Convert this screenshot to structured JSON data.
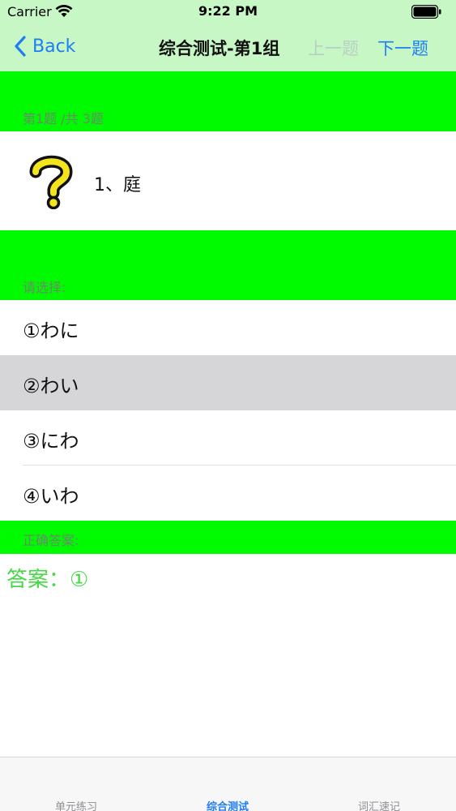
{
  "status_bar": {
    "carrier": "Carrier",
    "time": "9:22 PM"
  },
  "nav": {
    "back_label": "Back",
    "title": "综合测试-第1组",
    "prev_label": "上一题",
    "next_label": "下一题"
  },
  "question": {
    "counter": "第1题 /共 3题",
    "text": "1、庭",
    "icon": "question-mark-icon"
  },
  "options": {
    "header": "请选择:",
    "items": [
      {
        "label": "①わに"
      },
      {
        "label": "②わい"
      },
      {
        "label": "③にわ"
      },
      {
        "label": "④いわ"
      }
    ],
    "selected_index": 1
  },
  "correct_answer": {
    "header": "正确答案:",
    "text": "答案：①"
  },
  "tabbar": {
    "items": [
      {
        "label": "单元练习"
      },
      {
        "label": "综合测试"
      },
      {
        "label": "词汇速记"
      }
    ],
    "active_index": 1
  },
  "colors": {
    "accent": "#1f7df5",
    "header_bg": "#c6f7c4",
    "section_bg": "#00fb00",
    "answer_text": "#45d845",
    "selected_row": "#d6d6d9"
  }
}
